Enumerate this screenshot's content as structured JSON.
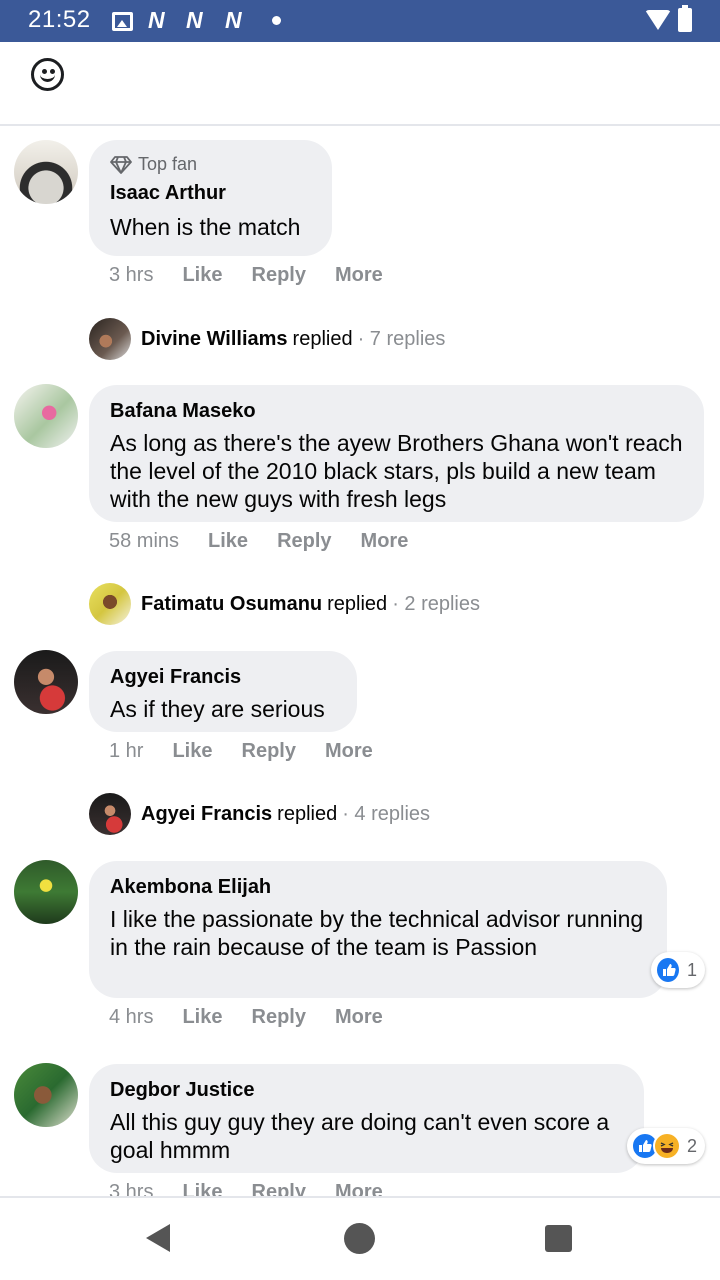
{
  "status_bar": {
    "time": "21:52",
    "icons": [
      "image-icon",
      "n-icon",
      "n-icon",
      "n-icon",
      "dot-icon",
      "wifi-icon",
      "battery-icon"
    ],
    "n_label": "N",
    "background": "#3b5998"
  },
  "comments": [
    {
      "badge": "Top fan",
      "name": "Isaac Arthur",
      "text": "When is the match",
      "time": "3 hrs",
      "like": "Like",
      "reply": "Reply",
      "more": "More",
      "replied": {
        "name": "Divine Williams",
        "word": "replied",
        "count": "· 7 replies"
      }
    },
    {
      "name": "Bafana Maseko",
      "text": "As long as there's the ayew Brothers Ghana won't reach the level of the 2010 black stars, pls build a new team with the new guys with fresh legs",
      "time": "58 mins",
      "like": "Like",
      "reply": "Reply",
      "more": "More",
      "replied": {
        "name": "Fatimatu Osumanu",
        "word": "replied",
        "count": "· 2 replies"
      }
    },
    {
      "name": "Agyei Francis",
      "text": "As if they are serious",
      "time": "1 hr",
      "like": "Like",
      "reply": "Reply",
      "more": "More",
      "replied": {
        "name": "Agyei Francis",
        "word": "replied",
        "count": "· 4 replies"
      }
    },
    {
      "name": "Akembona Elijah",
      "text": "I like the passionate by the technical advisor running in the rain because of the team is Passion",
      "time": "4 hrs",
      "like": "Like",
      "reply": "Reply",
      "more": "More",
      "reactions": {
        "count": "1",
        "types": [
          "like-icon"
        ]
      }
    },
    {
      "name": "Degbor Justice",
      "text": "All this guy guy they are doing can't even score a goal hmmm",
      "time": "3 hrs",
      "like": "Like",
      "reply": "Reply",
      "more": "More",
      "reactions": {
        "count": "2",
        "types": [
          "like-icon",
          "haha-icon"
        ]
      }
    }
  ],
  "colors": {
    "bubble": "#eeeff2",
    "meta_text": "#8a8d91",
    "like_blue": "#1877f2",
    "haha_yellow": "#f7b125"
  }
}
